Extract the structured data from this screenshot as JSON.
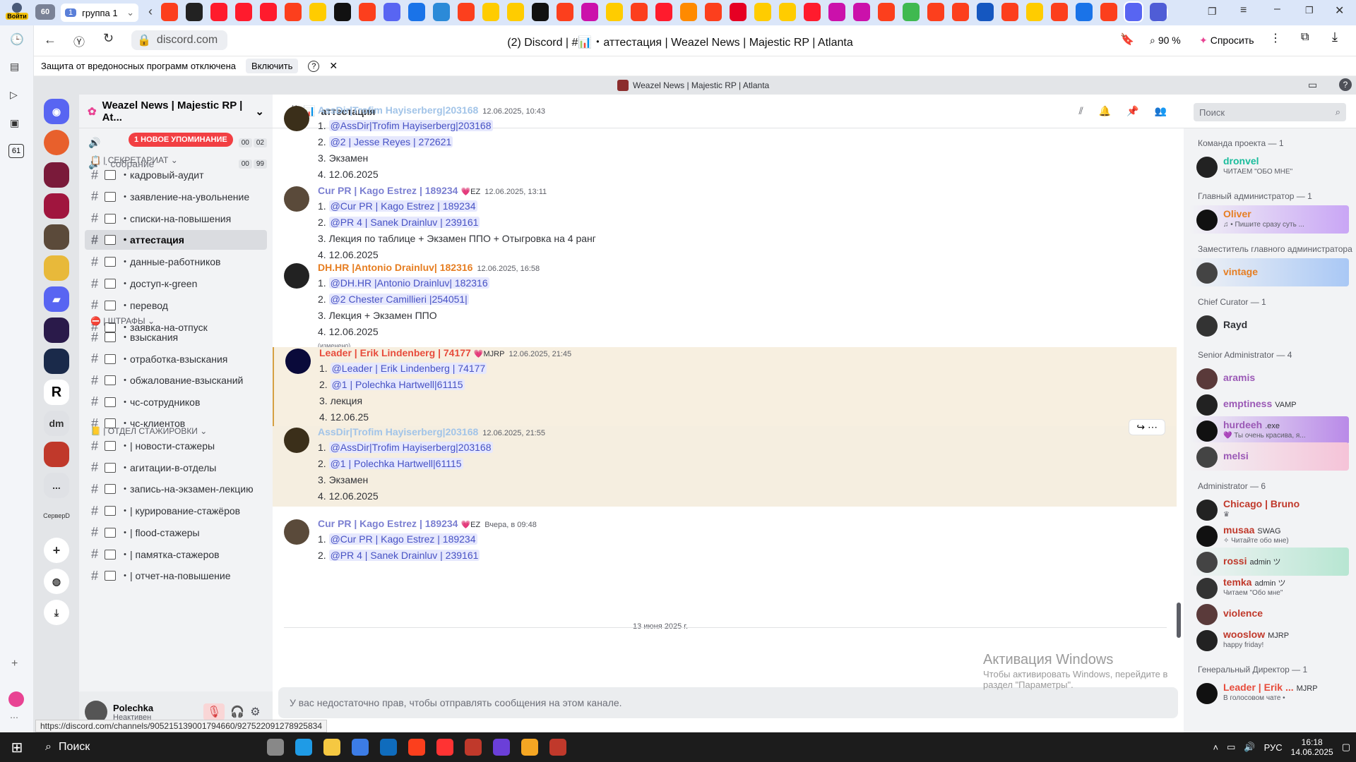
{
  "browser": {
    "login_label": "Войти",
    "tab_count": "60",
    "group_label": "группа 1",
    "group_count": "1",
    "tab_icons": [
      "yandex",
      "circle-dark",
      "opera",
      "opera",
      "opera",
      "yandex",
      "play",
      "r-square",
      "yandex",
      "discord",
      "mail",
      "globe",
      "yandex",
      "play",
      "play",
      "plus",
      "yandex",
      "wb",
      "play",
      "yandex",
      "opera",
      "fire",
      "yandex",
      "pinterest",
      "play",
      "play",
      "opera",
      "wb",
      "wb",
      "yandex",
      "hd",
      "yandex",
      "yandex",
      "note",
      "yandex",
      "play",
      "yandex",
      "mail",
      "yandex",
      "discord-active",
      "list"
    ],
    "url": "discord.com",
    "page_title": "(2) Discord | #📊・аттестация | Weazel News | Majestic RP | Atlanta",
    "zoom": "90 %",
    "ask_label": "Спросить",
    "warning_text": "Защита от вредоносных программ отключена",
    "enable_label": "Включить",
    "status_url": "https://discord.com/channels/905215139001794660/927522091278925834",
    "side_badge": "61"
  },
  "discord": {
    "window_title": "Weazel News | Majestic RP | Atlanta",
    "server_name": "Weazel News | Majestic RP | At...",
    "mention_pill": "1 НОВОЕ УПОМИНАНИЕ",
    "voice_channels": [
      {
        "name": "",
        "nums": [
          "00",
          "02"
        ]
      },
      {
        "name": "собрание",
        "nums": [
          "00",
          "99"
        ]
      }
    ],
    "categories": {
      "secretariat": "| СЕКРЕТАРИАТ",
      "fines": "| ШТРАФЫ",
      "interns": "| ОТДЕЛ СТАЖИРОВКИ"
    },
    "channels_secretariat": [
      "кадровый-аудит",
      "заявление-на-увольнение",
      "списки-на-повышения",
      "аттестация",
      "данные-работников",
      "доступ-к-green",
      "перевод",
      "заявка-на-отпуск"
    ],
    "channels_fines": [
      "взыскания",
      "отработка-взыскания",
      "обжалование-взысканий",
      "чс-сотрудников",
      "чс-клиентов"
    ],
    "channels_interns": [
      "| новости-стажеры",
      "агитации-в-отделы",
      "запись-на-экзамен-лекцию",
      "| курирование-стажёров",
      "| flood-стажеры",
      "| памятка-стажеров",
      "| отчет-на-повышение"
    ],
    "guild_badges": {
      "server_dm": "dm",
      "server_d": "СерверD",
      "more": "..."
    },
    "user": {
      "name": "Polechka",
      "status": "Неактивен"
    },
    "channel_name": "аттестация",
    "search_placeholder": "Поиск",
    "messages": [
      {
        "author": "AssDir|Trofim Hayiserberg|203168",
        "tag": "",
        "time": "12.06.2025, 10:43",
        "color": "#a2c4e8",
        "lines": [
          "1. @AssDir|Trofim Hayiserberg|203168",
          "2. @2 | Jesse Reyes | 272621",
          "3. Экзамен",
          "4. 12.06.2025"
        ]
      },
      {
        "author": "Cur PR | Kago Estrez | 189234",
        "tag": "💗EZ",
        "time": "12.06.2025, 13:11",
        "color": "#7b7fd1",
        "lines": [
          "1. @Cur PR | Kago Estrez | 189234",
          "2. @PR 4 | Sanek Drainluv | 239161",
          "3. Лекция по таблице + Экзамен ППО + Отыгровка на 4 ранг",
          "4. 12.06.2025"
        ]
      },
      {
        "author": "DH.HR |Antonio Drainluv| 182316",
        "tag": "",
        "time": "12.06.2025, 16:58",
        "color": "#e67e22",
        "lines": [
          "1. @DH.HR |Antonio Drainluv| 182316",
          "2. @2 Chester Camillieri |254051|",
          "3. Лекция + Экзамен ППО",
          "4. 12.06.2025"
        ],
        "edited": "(изменено)"
      },
      {
        "author": "Leader | Erik Lindenberg | 74177",
        "tag": "💗MJRP",
        "time": "12.06.2025, 21:45",
        "color": "#e74c3c",
        "lines": [
          "1. @Leader | Erik Lindenberg | 74177",
          "2. @1 | Polechka Hartwell|61115",
          "3. лекция",
          "4. 12.06.25"
        ]
      },
      {
        "author": "AssDir|Trofim Hayiserberg|203168",
        "tag": "",
        "time": "12.06.2025, 21:55",
        "color": "#a2c4e8",
        "lines": [
          "1. @AssDir|Trofim Hayiserberg|203168",
          "2. @1 | Polechka Hartwell|61115",
          "3. Экзамен",
          "4. 12.06.2025"
        ]
      },
      {
        "author": "Cur PR | Kago Estrez | 189234",
        "tag": "💗EZ",
        "time": "Вчера, в 09:48",
        "color": "#7b7fd1",
        "lines": [
          "1. @Cur PR | Kago Estrez | 189234",
          "2. @PR 4 | Sanek Drainluv | 239161"
        ]
      }
    ],
    "date_divider": "13 июня 2025 г.",
    "no_perm": "У вас недостаточно прав, чтобы отправлять сообщения на этом канале.",
    "activation_title": "Активация Windows",
    "activation_sub": "Чтобы активировать Windows, перейдите в раздел \"Параметры\".",
    "member_groups": [
      {
        "title": "Команда проекта — 1",
        "members": [
          {
            "name": "dronvel",
            "color": "#1abc9c",
            "status": "ЧИТАЕМ \"ОБО МНЕ\""
          }
        ]
      },
      {
        "title": "Главный администратор — 1",
        "members": [
          {
            "name": "Oliver",
            "color": "#e67e22",
            "status": "♫ • Пишите сразу суть ..."
          }
        ]
      },
      {
        "title": "Заместитель главного администратора",
        "members": [
          {
            "name": "vintage",
            "color": "#e67e22",
            "status": ""
          }
        ]
      },
      {
        "title": "Chief Curator — 1",
        "members": [
          {
            "name": "Rayd",
            "color": "#313338",
            "status": ""
          }
        ]
      },
      {
        "title": "Senior Administrator — 4",
        "members": [
          {
            "name": "aramis",
            "color": "#9b59b6",
            "status": ""
          },
          {
            "name": "emptiness",
            "color": "#9b59b6",
            "status": "",
            "tag": "VAMP"
          },
          {
            "name": "hurdeeh",
            "color": "#9b59b6",
            "status": "💜 Ты очень красива, я...",
            "tag": ".exe"
          },
          {
            "name": "melsi",
            "color": "#9b59b6",
            "status": ""
          }
        ]
      },
      {
        "title": "Administrator — 6",
        "members": [
          {
            "name": "Chicago | Bruno",
            "color": "#c0392b",
            "status": "♛"
          },
          {
            "name": "musaa",
            "color": "#c0392b",
            "status": "✧ Читайте обо мне)",
            "tag": "SWAG"
          },
          {
            "name": "rossi",
            "color": "#c0392b",
            "status": "",
            "tag": "admin ツ"
          },
          {
            "name": "temka",
            "color": "#c0392b",
            "status": "Читаем \"Обо мне\"",
            "tag": "admin ツ"
          },
          {
            "name": "violence",
            "color": "#c0392b",
            "status": ""
          },
          {
            "name": "wooslow",
            "color": "#c0392b",
            "status": "happy friday!",
            "tag": "MJRP"
          }
        ]
      },
      {
        "title": "Генеральный Директор — 1",
        "members": [
          {
            "name": "Leader | Erik ...",
            "color": "#e74c3c",
            "status": "В голосовом чате •",
            "tag": "MJRP"
          }
        ]
      }
    ]
  },
  "taskbar": {
    "search_label": "Поиск",
    "lang": "РУС",
    "time": "16:18",
    "date": "14.06.2025"
  }
}
